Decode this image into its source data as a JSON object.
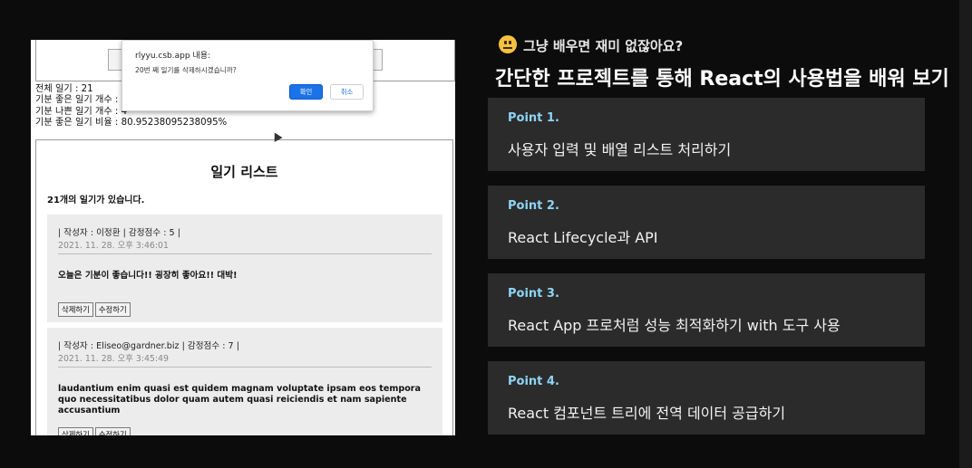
{
  "browser": {
    "stats": [
      "전체 일기 : 21",
      "기분 좋은 일기 개수 : 1",
      "기분 나쁜 일기 개수 : 4",
      "기분 좋은 일기 비율 : 80.95238095238095%"
    ],
    "list": {
      "title": "일기 리스트",
      "count_text": "21개의 일기가 있습니다.",
      "entries": [
        {
          "meta": "| 작성자 : 이정환 | 감정점수 : 5 |",
          "date": "2021. 11. 28. 오후 3:46:01",
          "content": "오늘은 기분이 좋습니다!! 굉장히 좋아요!! 대박!",
          "delete_label": "삭제하기",
          "edit_label": "수정하기"
        },
        {
          "meta": "| 작성자 : Eliseo@gardner.biz | 감정점수 : 7 |",
          "date": "2021. 11. 28. 오후 3:45:49",
          "content": "laudantium enim quasi est quidem magnam voluptate ipsam eos tempora quo necessitatibus dolor quam autem quasi reiciendis et nam sapiente accusantium",
          "delete_label": "삭제하기",
          "edit_label": "수정하기"
        }
      ]
    },
    "dialog": {
      "title": "rlyyu.csb.app 내용:",
      "message": "20번 째 일기를 삭제하시겠습니까?",
      "ok_label": "확인",
      "cancel_label": "취소"
    }
  },
  "slide": {
    "subheading": "그냥 배우면 재미 없잖아요?",
    "heading": "간단한 프로젝트를 통해 React의 사용법을 배워 보기",
    "points": [
      {
        "label": "Point 1.",
        "text": "사용자 입력 및 배열 리스트 처리하기"
      },
      {
        "label": "Point 2.",
        "text": "React Lifecycle과 API"
      },
      {
        "label": "Point 3.",
        "text": "React App 프로처럼 성능 최적화하기 with 도구 사용"
      },
      {
        "label": "Point 4.",
        "text": "React 컴포넌트 트리에 전역 데이터 공급하기"
      }
    ],
    "colors": {
      "accent": "#8ed4f5",
      "card_bg": "#2b2b2b",
      "background": "#0c0c0c"
    },
    "emoji_icon": "neutral-face-icon"
  }
}
